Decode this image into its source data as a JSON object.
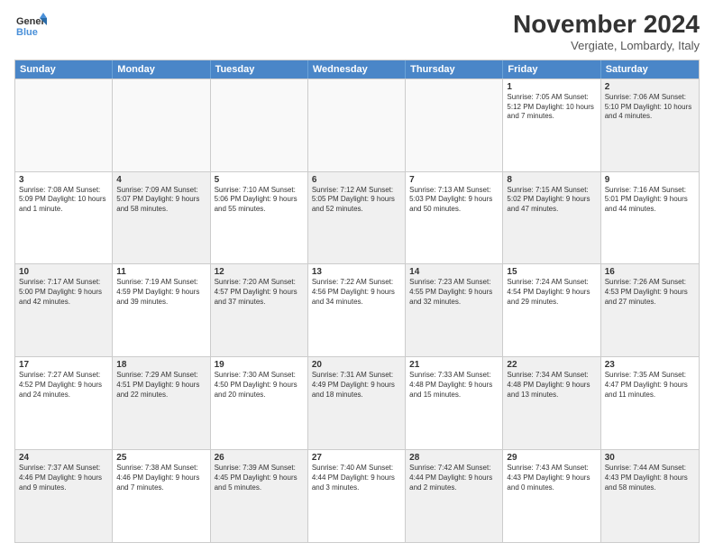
{
  "header": {
    "logo_line1": "General",
    "logo_line2": "Blue",
    "month_title": "November 2024",
    "location": "Vergiate, Lombardy, Italy"
  },
  "day_headers": [
    "Sunday",
    "Monday",
    "Tuesday",
    "Wednesday",
    "Thursday",
    "Friday",
    "Saturday"
  ],
  "weeks": [
    [
      {
        "num": "",
        "info": "",
        "empty": true
      },
      {
        "num": "",
        "info": "",
        "empty": true
      },
      {
        "num": "",
        "info": "",
        "empty": true
      },
      {
        "num": "",
        "info": "",
        "empty": true
      },
      {
        "num": "",
        "info": "",
        "empty": true
      },
      {
        "num": "1",
        "info": "Sunrise: 7:05 AM\nSunset: 5:12 PM\nDaylight: 10 hours and 7 minutes.",
        "empty": false,
        "shaded": false
      },
      {
        "num": "2",
        "info": "Sunrise: 7:06 AM\nSunset: 5:10 PM\nDaylight: 10 hours and 4 minutes.",
        "empty": false,
        "shaded": true
      }
    ],
    [
      {
        "num": "3",
        "info": "Sunrise: 7:08 AM\nSunset: 5:09 PM\nDaylight: 10 hours and 1 minute.",
        "empty": false,
        "shaded": false
      },
      {
        "num": "4",
        "info": "Sunrise: 7:09 AM\nSunset: 5:07 PM\nDaylight: 9 hours and 58 minutes.",
        "empty": false,
        "shaded": true
      },
      {
        "num": "5",
        "info": "Sunrise: 7:10 AM\nSunset: 5:06 PM\nDaylight: 9 hours and 55 minutes.",
        "empty": false,
        "shaded": false
      },
      {
        "num": "6",
        "info": "Sunrise: 7:12 AM\nSunset: 5:05 PM\nDaylight: 9 hours and 52 minutes.",
        "empty": false,
        "shaded": true
      },
      {
        "num": "7",
        "info": "Sunrise: 7:13 AM\nSunset: 5:03 PM\nDaylight: 9 hours and 50 minutes.",
        "empty": false,
        "shaded": false
      },
      {
        "num": "8",
        "info": "Sunrise: 7:15 AM\nSunset: 5:02 PM\nDaylight: 9 hours and 47 minutes.",
        "empty": false,
        "shaded": true
      },
      {
        "num": "9",
        "info": "Sunrise: 7:16 AM\nSunset: 5:01 PM\nDaylight: 9 hours and 44 minutes.",
        "empty": false,
        "shaded": false
      }
    ],
    [
      {
        "num": "10",
        "info": "Sunrise: 7:17 AM\nSunset: 5:00 PM\nDaylight: 9 hours and 42 minutes.",
        "empty": false,
        "shaded": true
      },
      {
        "num": "11",
        "info": "Sunrise: 7:19 AM\nSunset: 4:59 PM\nDaylight: 9 hours and 39 minutes.",
        "empty": false,
        "shaded": false
      },
      {
        "num": "12",
        "info": "Sunrise: 7:20 AM\nSunset: 4:57 PM\nDaylight: 9 hours and 37 minutes.",
        "empty": false,
        "shaded": true
      },
      {
        "num": "13",
        "info": "Sunrise: 7:22 AM\nSunset: 4:56 PM\nDaylight: 9 hours and 34 minutes.",
        "empty": false,
        "shaded": false
      },
      {
        "num": "14",
        "info": "Sunrise: 7:23 AM\nSunset: 4:55 PM\nDaylight: 9 hours and 32 minutes.",
        "empty": false,
        "shaded": true
      },
      {
        "num": "15",
        "info": "Sunrise: 7:24 AM\nSunset: 4:54 PM\nDaylight: 9 hours and 29 minutes.",
        "empty": false,
        "shaded": false
      },
      {
        "num": "16",
        "info": "Sunrise: 7:26 AM\nSunset: 4:53 PM\nDaylight: 9 hours and 27 minutes.",
        "empty": false,
        "shaded": true
      }
    ],
    [
      {
        "num": "17",
        "info": "Sunrise: 7:27 AM\nSunset: 4:52 PM\nDaylight: 9 hours and 24 minutes.",
        "empty": false,
        "shaded": false
      },
      {
        "num": "18",
        "info": "Sunrise: 7:29 AM\nSunset: 4:51 PM\nDaylight: 9 hours and 22 minutes.",
        "empty": false,
        "shaded": true
      },
      {
        "num": "19",
        "info": "Sunrise: 7:30 AM\nSunset: 4:50 PM\nDaylight: 9 hours and 20 minutes.",
        "empty": false,
        "shaded": false
      },
      {
        "num": "20",
        "info": "Sunrise: 7:31 AM\nSunset: 4:49 PM\nDaylight: 9 hours and 18 minutes.",
        "empty": false,
        "shaded": true
      },
      {
        "num": "21",
        "info": "Sunrise: 7:33 AM\nSunset: 4:48 PM\nDaylight: 9 hours and 15 minutes.",
        "empty": false,
        "shaded": false
      },
      {
        "num": "22",
        "info": "Sunrise: 7:34 AM\nSunset: 4:48 PM\nDaylight: 9 hours and 13 minutes.",
        "empty": false,
        "shaded": true
      },
      {
        "num": "23",
        "info": "Sunrise: 7:35 AM\nSunset: 4:47 PM\nDaylight: 9 hours and 11 minutes.",
        "empty": false,
        "shaded": false
      }
    ],
    [
      {
        "num": "24",
        "info": "Sunrise: 7:37 AM\nSunset: 4:46 PM\nDaylight: 9 hours and 9 minutes.",
        "empty": false,
        "shaded": true
      },
      {
        "num": "25",
        "info": "Sunrise: 7:38 AM\nSunset: 4:46 PM\nDaylight: 9 hours and 7 minutes.",
        "empty": false,
        "shaded": false
      },
      {
        "num": "26",
        "info": "Sunrise: 7:39 AM\nSunset: 4:45 PM\nDaylight: 9 hours and 5 minutes.",
        "empty": false,
        "shaded": true
      },
      {
        "num": "27",
        "info": "Sunrise: 7:40 AM\nSunset: 4:44 PM\nDaylight: 9 hours and 3 minutes.",
        "empty": false,
        "shaded": false
      },
      {
        "num": "28",
        "info": "Sunrise: 7:42 AM\nSunset: 4:44 PM\nDaylight: 9 hours and 2 minutes.",
        "empty": false,
        "shaded": true
      },
      {
        "num": "29",
        "info": "Sunrise: 7:43 AM\nSunset: 4:43 PM\nDaylight: 9 hours and 0 minutes.",
        "empty": false,
        "shaded": false
      },
      {
        "num": "30",
        "info": "Sunrise: 7:44 AM\nSunset: 4:43 PM\nDaylight: 8 hours and 58 minutes.",
        "empty": false,
        "shaded": true
      }
    ]
  ]
}
